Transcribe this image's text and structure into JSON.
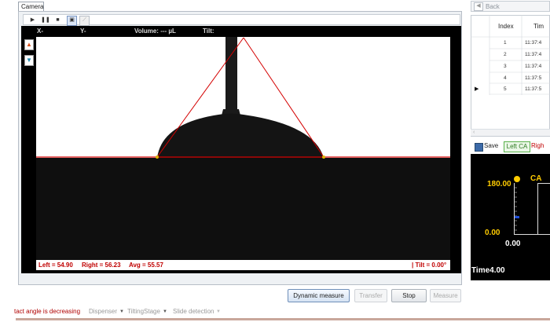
{
  "camera": {
    "tab_label": "Camera",
    "header": {
      "x_label": "X-",
      "y_label": "Y-",
      "volume_label": "Volume: --- µL",
      "tilt_label": "Tilt:"
    },
    "status": {
      "left": "Left = 54.90",
      "right": "Right = 56.23",
      "avg": "Avg = 55.57",
      "tilt": "| Tilt = 0.00°"
    }
  },
  "buttons": {
    "dynamic_measure": "Dynamic measure",
    "transfer": "Transfer",
    "stop": "Stop",
    "measure": "Measure"
  },
  "bottom": {
    "message": "tact angle is decreasing",
    "dispenser": "Dispenser",
    "tilting_stage": "TiltingStage",
    "slide_detection": "Slide detection"
  },
  "right_panel": {
    "back_label": "Back",
    "table": {
      "columns": [
        "Index",
        "Tim"
      ],
      "rows": [
        {
          "index": "1",
          "time": "11:37:4"
        },
        {
          "index": "2",
          "time": "11:37:4"
        },
        {
          "index": "3",
          "time": "11:37:4"
        },
        {
          "index": "4",
          "time": "11:37:5"
        },
        {
          "index": "5",
          "time": "11:37:5"
        }
      ]
    },
    "save_label": "Save",
    "left_ca_label": "Left CA",
    "right_ca_label": "Righ",
    "gauge": {
      "title": "CA",
      "max_label": "180.00",
      "min_label": "0.00",
      "x_zero_label": "0.00",
      "time_label": "Time4.00"
    }
  },
  "colors": {
    "fit_line": "#d40000",
    "gauge_text": "#ffcc00",
    "status_red": "#c00000"
  },
  "icons": [
    "play-icon",
    "pause-icon",
    "stop-icon",
    "image-icon",
    "chart-icon",
    "arrow-up-icon",
    "arrow-down-icon",
    "back-icon",
    "save-icon",
    "dropdown-icon"
  ]
}
